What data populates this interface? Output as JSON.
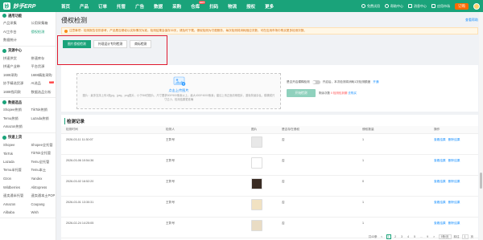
{
  "app": {
    "logo_text": "妙手ERP",
    "brand_color": "#1aa37a"
  },
  "topnav": {
    "items": [
      {
        "label": "首页",
        "hot": ""
      },
      {
        "label": "产品",
        "hot": ""
      },
      {
        "label": "订单",
        "hot": ""
      },
      {
        "label": "托管",
        "hot": ""
      },
      {
        "label": "广告",
        "hot": ""
      },
      {
        "label": "数据",
        "hot": ""
      },
      {
        "label": "采购",
        "hot": ""
      },
      {
        "label": "仓库",
        "hot": "HOT"
      },
      {
        "label": "扫码",
        "hot": ""
      },
      {
        "label": "物流",
        "hot": ""
      },
      {
        "label": "授权",
        "hot": ""
      },
      {
        "label": "更多",
        "hot": ""
      }
    ],
    "right": {
      "item1": "免费试用",
      "item2": "帮助中心",
      "item3": "消息中心",
      "item4": "应用市场",
      "recharge": "订购"
    }
  },
  "sidebar": {
    "sections": [
      {
        "title": "通用功能",
        "rows": [
          [
            "产品采集",
            "公用采集箱"
          ],
          [
            "AI工作台",
            "侵权检测"
          ],
          [
            "数据统计",
            ""
          ]
        ]
      },
      {
        "title": "货源中心",
        "rows": [
          [
            "拼速供货",
            "拼速库存"
          ],
          [
            "拼速产业带",
            "平台货源"
          ],
          [
            "1688采购",
            "1688精准采购"
          ],
          [
            "妙手精选货源",
            "AI选品"
          ],
          [
            "1688找同款",
            "数据选品分析"
          ]
        ]
      },
      {
        "title": "数据选品",
        "rows": [
          [
            "Shopee热销",
            "TikTok热销"
          ],
          [
            "Temu热销",
            "Lazada热销"
          ],
          [
            "Amazon热销",
            ""
          ]
        ]
      },
      {
        "title": "快速上货",
        "rows": [
          [
            "Shopee",
            "Shopee全托管"
          ],
          [
            "TikTok",
            "TikTok全托管"
          ],
          [
            "Lazada",
            "Temu全托管"
          ],
          [
            "Temu半托管",
            "Temu本土"
          ],
          [
            "Ozon",
            "Yandex"
          ],
          [
            "Wildberries",
            "AliExpress"
          ],
          [
            "速卖通半托管",
            "速卖通本土POP"
          ],
          [
            "Amazon",
            "Coupang"
          ],
          [
            "Alibaba",
            "Wish"
          ]
        ]
      }
    ],
    "active_item": "侵权检测"
  },
  "page": {
    "title": "侵权检测",
    "help_link": "查看帮助",
    "notice": "注意事项：检测报告仅供参考，产品是否侵权以实际情况为准。检测结果会保存30天，请及时下载。侵权检测为付费服务，每次检测将消耗相应次数，可在应用市场中购买更多检测次数。",
    "tabs": [
      "图片侵权检测",
      "外观设计专利检测",
      "商标检测"
    ],
    "active_tab": 0
  },
  "upload": {
    "button_label": "点击上传图片",
    "description": "图片：最多支持上传1张jpg、jpeg、png图片，小于5M的图片，尺寸要求500*500像素以上，最大4000*4000像素；建议上传正面清晰图片，避免背景杂乱，模糊或尺寸过小，检测结果更准确"
  },
  "options": {
    "switch_label": "是否开启模糊检测",
    "switch_state": "off",
    "note": "开启后，本次检测将消耗1次检测额度",
    "link": "开通",
    "detect_button": "开始检测",
    "remaining_prefix": "剩余次数",
    "remaining_count": "0",
    "expire_label": "检测包到期",
    "buy_link": "去购买"
  },
  "records": {
    "title": "检测记录",
    "columns": [
      "检测时间",
      "检测人",
      "图片",
      "是否存在侵权",
      "侵权数量",
      "操作"
    ],
    "rows": [
      {
        "time": "2026-03-11 11:30:07",
        "user": "王彰号",
        "thumb_color": "#e8e8e8",
        "infringe": "否",
        "count": "1",
        "op1": "查看结果",
        "op2": "删除结果"
      },
      {
        "time": "2026-03-06 10:54:36",
        "user": "王彰号",
        "thumb_color": "#ffffff",
        "infringe": "否",
        "count": "1",
        "op1": "查看结果",
        "op2": "删除结果"
      },
      {
        "time": "2026-03-02 16:52:20",
        "user": "王彰号",
        "thumb_color": "#3a2c24",
        "infringe": "否",
        "count": "0",
        "op1": "查看结果",
        "op2": "删除结果"
      },
      {
        "time": "2026-03-01 13:30:31",
        "user": "王彰号",
        "thumb_color": "#f1e2c2",
        "infringe": "否",
        "count": "1",
        "op1": "查看结果",
        "op2": "删除结果"
      },
      {
        "time": "2026-02-24 14:25:05",
        "user": "王彰号",
        "thumb_color": "#e9dcc4",
        "infringe": "否",
        "count": "1",
        "op1": "查看结果",
        "op2": "删除结果"
      }
    ]
  },
  "pagination": {
    "total": "共43条",
    "pages": [
      "<",
      "1",
      "2",
      "3",
      "4",
      "5",
      "...",
      "9",
      ">"
    ],
    "active_page": "1",
    "page_size": "5条/页",
    "goto_label": "前往",
    "goto_value": "1",
    "page_suffix": "页"
  }
}
